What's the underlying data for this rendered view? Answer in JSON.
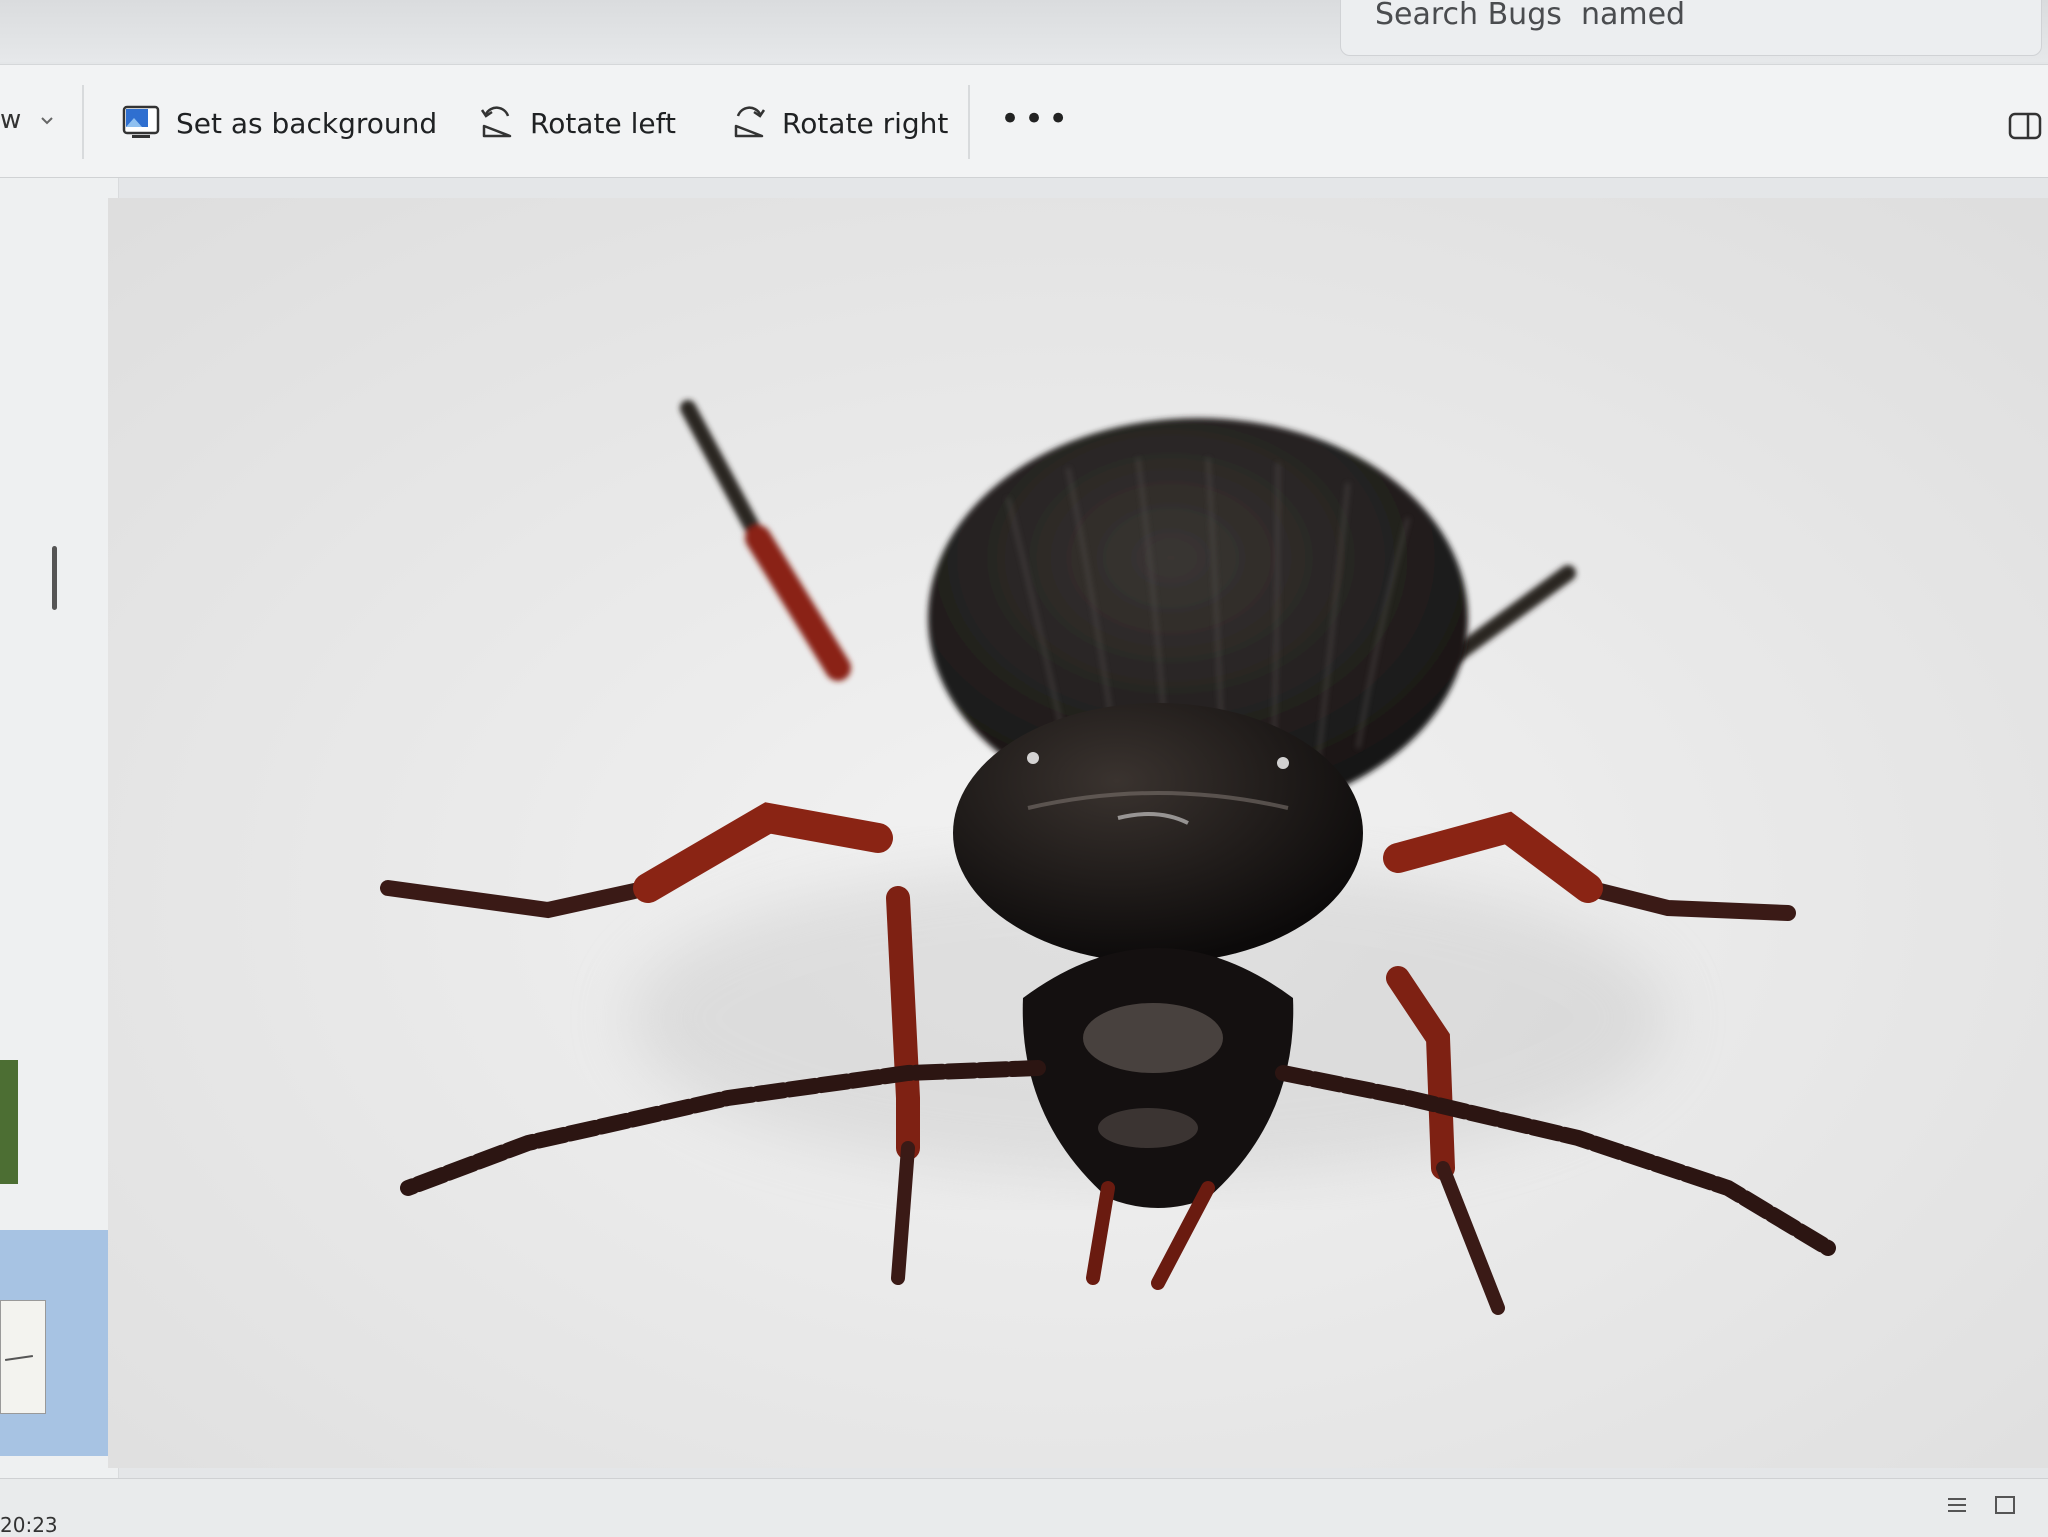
{
  "search": {
    "placeholder": "Search Bugs  named"
  },
  "toolbar": {
    "view_partial": "w",
    "set_background": "Set as background",
    "rotate_left": "Rotate left",
    "rotate_right": "Rotate right",
    "more": "•••"
  },
  "icons": {
    "view": "chevron-down-icon",
    "set_background": "desktop-picture-icon",
    "rotate_left": "rotate-left-icon",
    "rotate_right": "rotate-right-icon",
    "panel": "side-panel-icon"
  },
  "photo": {
    "subject": "beetle"
  },
  "statusbar": {
    "time": "20:23"
  }
}
